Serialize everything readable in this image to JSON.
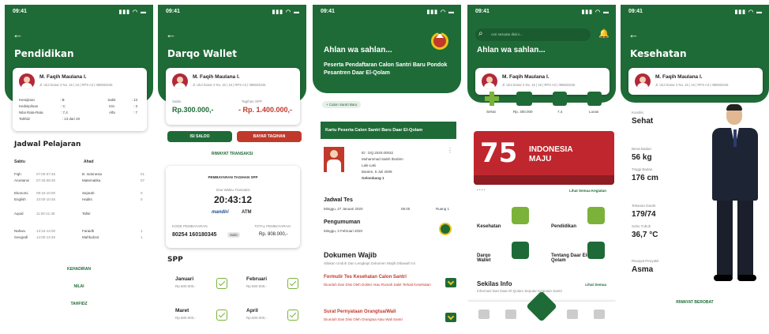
{
  "status_time": "09:41",
  "status_icons": "▮▮▮ ◠ ▬",
  "back_arrow": "←",
  "user": {
    "name": "M. Faqih Maulana I.",
    "address": "Jl. Ulul Kiarar 2 No. 16 | 16 | RPS A3 | 088833345"
  },
  "s1": {
    "title": "Pendidikan",
    "stats": [
      {
        "label": "Keraijinan",
        "value": ": B",
        "label2": "Sakit",
        "value2": ": 13"
      },
      {
        "label": "Kedisiplinan",
        "value": ": C",
        "label2": "Izin",
        "value2": ": 3"
      },
      {
        "label": "Nilai Rata-Rata",
        "value": ": 7,4",
        "label2": "Alfa",
        "value2": ": 7"
      },
      {
        "label": "Tahfidz",
        "value": ": 13 dari 20",
        "label2": "",
        "value2": ""
      }
    ],
    "schedule_title": "Jadwal Pelajaran",
    "day1": "Sabtu",
    "day2": "Ahad",
    "rows": [
      {
        "s1": "Fiqh",
        "t1": "07:00-07:45",
        "s2": "B. Indonesia",
        "n2": "01"
      },
      {
        "s1": "Aruntansi",
        "t1": "07:45-08:30",
        "s2": "Matematika",
        "n2": "07"
      },
      {
        "s1": "Ekonomi",
        "t1": "09:15-10:00",
        "s2": "Sejarah",
        "n2": "0"
      },
      {
        "s1": "English",
        "t1": "10:00-10:45",
        "s2": "Hadits",
        "n2": "0"
      },
      {
        "s1": "Aqoid",
        "t1": "11:00-11:45",
        "s2": "Tafsir",
        "n2": ""
      },
      {
        "s1": "Nahwu",
        "t1": "13:15-14:00",
        "s2": "Faraidh",
        "n2": "1"
      },
      {
        "s1": "Geografi",
        "t1": "14:00-14:45",
        "s2": "Mahfudzat",
        "n2": "1"
      }
    ],
    "links": [
      "KEHADIRAN",
      "NILAI",
      "TAHFIDZ"
    ]
  },
  "s2": {
    "title": "Darqo Wallet",
    "saldo_label": "Saldo",
    "saldo_value": "Rp.300.000,-",
    "tagihan_label": "Tagihan SPP",
    "tagihan_value": "- Rp. 1.400.000,-",
    "btn_saldo": "ISI SALDO",
    "btn_bayar": "BAYAR TAGIHAN",
    "riwayat": "RIWAYAT TRANSAKSI",
    "payment_title": "PEMBAYARAN TAGIHAN SPP",
    "batas_label": "Sisa Waktu Transaksi",
    "time": "20:43:12",
    "bank1": "mandiri",
    "bank2": "ATM",
    "va_label": "KODE PEMBAYARAN",
    "va_value": "80254 160180345",
    "salin": "Salin",
    "total_label": "TOTAL PEMBAYARAN",
    "total_value": "Rp. 808.000,-",
    "spp_title": "SPP",
    "months": [
      {
        "name": "Januari",
        "amount": "Rp.600.000,-"
      },
      {
        "name": "Februari",
        "amount": "Rp.600.000,-"
      },
      {
        "name": "Maret",
        "amount": "Rp.600.000,-"
      },
      {
        "name": "April",
        "amount": "Rp.600.000,-"
      }
    ]
  },
  "s3": {
    "greeting": "Ahlan wa sahlan...",
    "subtitle": "Peserta Pendaftaran Calon Santri Baru Pondok Pesantren Daar El-Qolam",
    "chip": "+ Calon Santri Baru",
    "card_title": "Kartu Peserta Calon Santri Baru Daar El-Qolam",
    "id_lines": [
      "ID : DQ.2020.00032",
      "Muhammad Saleh Ibrahim",
      "Laki-Laki",
      "Banten, 6 Juli 2008",
      "Gelombang 1"
    ],
    "jadwal_title": "Jadwal Tes",
    "jadwal_date": "Minggu, 27 Januari 2020",
    "jadwal_time": "08.00",
    "jadwal_room": "Ruang 1",
    "pengumuman_title": "Pengumuman",
    "pengumuman_date": "Minggu, 3 Februari 2020",
    "dok_title": "Dokumen Wajib",
    "dok_sub": "Silakan Unduh Dan Lengkapi Dokumen Wajib Dibawah Ini",
    "doc1": "Formulir Tes Kesehatan Calon Santri",
    "doc1_sub": "Diunduh Dan Diisi Oleh Dokter Atau Rumah Sakit Terkait Kesehatan",
    "doc2": "Surat Pernyataan Orangtua/Wali",
    "doc2_sub": "Diunduh Dan Diisi Oleh Orangtua Atau Wali Santri"
  },
  "s4": {
    "search_placeholder": "cari sesuatu disini...",
    "greeting": "Ahlan wa sahlan...",
    "quick": [
      {
        "label": "Sehat"
      },
      {
        "label": "Rp. 300.000"
      },
      {
        "label": "7,4"
      },
      {
        "label": "Lunas"
      }
    ],
    "banner_title": "INDONESIA",
    "banner_sub": "MAJU",
    "banner_num": "75",
    "lihat_kegiatan": "Lihat Semua Kegiatan",
    "menu": [
      "Kesehatan",
      "Pendidikan",
      "Darqo Wallet",
      "Tentang Daar El-Qolam"
    ],
    "sekilas": "Sekilas Info",
    "sekilas_sub": "Informasi Dari Daar El-Qolam Seputar Kegiatan Santri",
    "lihat_info": "Lihat Semua"
  },
  "s5": {
    "title": "Kesehatan",
    "fields": [
      {
        "label": "Kondisi",
        "value": "Sehat"
      },
      {
        "label": "Berat Badan",
        "value": "56 kg"
      },
      {
        "label": "Tinggi Badan",
        "value": "176 cm"
      },
      {
        "label": "Tekanan Darah",
        "value": "179/74"
      },
      {
        "label": "Suhu Tubuh",
        "value": "36,7 °C"
      },
      {
        "label": "Riwayat Penyakit",
        "value": "Asma"
      }
    ],
    "riwayat": "RIWAYAT BEROBAT"
  },
  "colors": {
    "primary": "#1f6b37",
    "accent": "#7bb23a",
    "danger": "#c0392b",
    "gold": "#e8c51b"
  }
}
